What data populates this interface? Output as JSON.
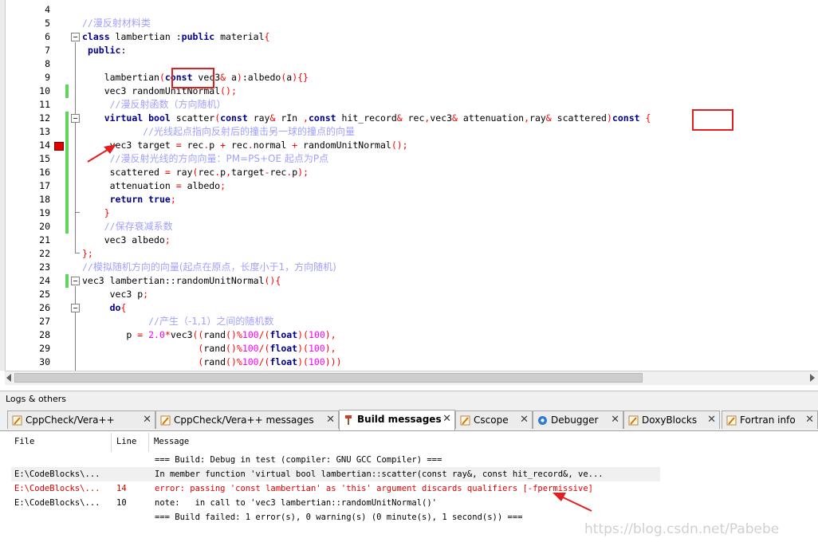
{
  "editor": {
    "lines": [
      {
        "num": "4",
        "tokens": []
      },
      {
        "num": "5",
        "tokens": [
          [
            "c",
            "//漫反射材料类"
          ]
        ]
      },
      {
        "num": "6",
        "tokens": [
          [
            "k",
            "class"
          ],
          [
            "",
            " lambertian :"
          ],
          [
            "k",
            "public"
          ],
          [
            "",
            " material"
          ],
          [
            "s",
            "{"
          ]
        ]
      },
      {
        "num": "7",
        "tokens": [
          [
            "",
            " "
          ],
          [
            "k",
            "public"
          ],
          [
            "",
            ":"
          ]
        ]
      },
      {
        "num": "8",
        "tokens": []
      },
      {
        "num": "9",
        "tokens": [
          [
            "",
            "    lambertian"
          ],
          [
            "s",
            "("
          ],
          [
            "k",
            "const"
          ],
          [
            "",
            " vec3"
          ],
          [
            "s",
            "&"
          ],
          [
            "",
            " a"
          ],
          [
            "s",
            ")"
          ],
          [
            "",
            ":albedo"
          ],
          [
            "s",
            "("
          ],
          [
            "",
            "a"
          ],
          [
            "s",
            "){}"
          ]
        ]
      },
      {
        "num": "10",
        "tokens": [
          [
            "",
            "    vec3 randomUnitNormal"
          ],
          [
            "s",
            "();"
          ]
        ]
      },
      {
        "num": "11",
        "tokens": [
          [
            "",
            "     "
          ],
          [
            "c",
            "//漫反射函数（方向随机）"
          ]
        ]
      },
      {
        "num": "12",
        "tokens": [
          [
            "",
            "    "
          ],
          [
            "k",
            "virtual"
          ],
          [
            "",
            " "
          ],
          [
            "k",
            "bool"
          ],
          [
            "",
            " scatter"
          ],
          [
            "s",
            "("
          ],
          [
            "k",
            "const"
          ],
          [
            "",
            " ray"
          ],
          [
            "s",
            "&"
          ],
          [
            "",
            " rIn "
          ],
          [
            "s",
            ","
          ],
          [
            "k",
            "const"
          ],
          [
            "",
            " hit_record"
          ],
          [
            "s",
            "&"
          ],
          [
            "",
            " rec"
          ],
          [
            "s",
            ","
          ],
          [
            "",
            "vec3"
          ],
          [
            "s",
            "&"
          ],
          [
            "",
            " attenuation"
          ],
          [
            "s",
            ","
          ],
          [
            "",
            "ray"
          ],
          [
            "s",
            "&"
          ],
          [
            "",
            " scattered"
          ],
          [
            "s",
            ")"
          ],
          [
            "k",
            "const"
          ],
          [
            "",
            " "
          ],
          [
            "s",
            "{"
          ]
        ]
      },
      {
        "num": "13",
        "tokens": [
          [
            "",
            "           "
          ],
          [
            "c",
            "//光线起点指向反射后的撞击另一球的撞点的向量"
          ]
        ]
      },
      {
        "num": "14",
        "tokens": [
          [
            "",
            "     vec3 target "
          ],
          [
            "s",
            "="
          ],
          [
            "",
            " rec"
          ],
          [
            "s",
            "."
          ],
          [
            "",
            "p "
          ],
          [
            "s",
            "+"
          ],
          [
            "",
            " rec"
          ],
          [
            "s",
            "."
          ],
          [
            "",
            "normal "
          ],
          [
            "s",
            "+"
          ],
          [
            "",
            " randomUnitNormal"
          ],
          [
            "s",
            "();"
          ]
        ]
      },
      {
        "num": "15",
        "tokens": [
          [
            "",
            "     "
          ],
          [
            "c",
            "//漫反射光线的方向向量：PM=PS+OE 起点为P点"
          ]
        ]
      },
      {
        "num": "16",
        "tokens": [
          [
            "",
            "     scattered "
          ],
          [
            "s",
            "="
          ],
          [
            "",
            " ray"
          ],
          [
            "s",
            "("
          ],
          [
            "",
            "rec"
          ],
          [
            "s",
            "."
          ],
          [
            "",
            "p"
          ],
          [
            "s",
            ","
          ],
          [
            "",
            "target"
          ],
          [
            "s",
            "-"
          ],
          [
            "",
            "rec"
          ],
          [
            "s",
            "."
          ],
          [
            "",
            "p"
          ],
          [
            "s",
            ");"
          ]
        ]
      },
      {
        "num": "17",
        "tokens": [
          [
            "",
            "     attenuation "
          ],
          [
            "s",
            "="
          ],
          [
            "",
            " albedo"
          ],
          [
            "s",
            ";"
          ]
        ]
      },
      {
        "num": "18",
        "tokens": [
          [
            "",
            "     "
          ],
          [
            "k",
            "return"
          ],
          [
            "",
            " "
          ],
          [
            "k",
            "true"
          ],
          [
            "s",
            ";"
          ]
        ]
      },
      {
        "num": "19",
        "tokens": [
          [
            "",
            "    "
          ],
          [
            "s",
            "}"
          ]
        ]
      },
      {
        "num": "20",
        "tokens": [
          [
            "",
            "    "
          ],
          [
            "c",
            "//保存衰减系数"
          ]
        ]
      },
      {
        "num": "21",
        "tokens": [
          [
            "",
            "    vec3 albedo"
          ],
          [
            "s",
            ";"
          ]
        ]
      },
      {
        "num": "22",
        "tokens": [
          [
            "s",
            "};"
          ]
        ]
      },
      {
        "num": "23",
        "tokens": [
          [
            "c",
            "//模拟随机方向的向量(起点在原点，长度小于1，方向随机)"
          ]
        ]
      },
      {
        "num": "24",
        "tokens": [
          [
            "",
            "vec3 lambertian::randomUnitNormal"
          ],
          [
            "s",
            "(){"
          ]
        ]
      },
      {
        "num": "25",
        "tokens": [
          [
            "",
            "     vec3 p"
          ],
          [
            "s",
            ";"
          ]
        ]
      },
      {
        "num": "26",
        "tokens": [
          [
            "",
            "     "
          ],
          [
            "k",
            "do"
          ],
          [
            "s",
            "{"
          ]
        ]
      },
      {
        "num": "27",
        "tokens": [
          [
            "",
            "            "
          ],
          [
            "c",
            "//产生（-1,1）之间的随机数"
          ]
        ]
      },
      {
        "num": "28",
        "tokens": [
          [
            "",
            "        p "
          ],
          [
            "s",
            "="
          ],
          [
            "",
            " "
          ],
          [
            "n",
            "2.0"
          ],
          [
            "s",
            "*"
          ],
          [
            "",
            "vec3"
          ],
          [
            "s",
            "(("
          ],
          [
            "",
            "rand"
          ],
          [
            "s",
            "()%"
          ],
          [
            "n",
            "100"
          ],
          [
            "s",
            "/("
          ],
          [
            "k",
            "float"
          ],
          [
            "s",
            ")("
          ],
          [
            "n",
            "100"
          ],
          [
            "s",
            "),"
          ]
        ]
      },
      {
        "num": "29",
        "tokens": [
          [
            "",
            "                     "
          ],
          [
            "s",
            "("
          ],
          [
            "",
            "rand"
          ],
          [
            "s",
            "()%"
          ],
          [
            "n",
            "100"
          ],
          [
            "s",
            "/("
          ],
          [
            "k",
            "float"
          ],
          [
            "s",
            ")("
          ],
          [
            "n",
            "100"
          ],
          [
            "s",
            "),"
          ]
        ]
      },
      {
        "num": "30",
        "tokens": [
          [
            "",
            "                     "
          ],
          [
            "s",
            "("
          ],
          [
            "",
            "rand"
          ],
          [
            "s",
            "()%"
          ],
          [
            "n",
            "100"
          ],
          [
            "s",
            "/("
          ],
          [
            "k",
            "float"
          ],
          [
            "s",
            ")("
          ],
          [
            "n",
            "100"
          ],
          [
            "s",
            ")))"
          ]
        ]
      }
    ]
  },
  "logs": {
    "title": "Logs & others",
    "tabs": [
      {
        "label": "CppCheck/Vera++",
        "icon": "pencil-icon",
        "active": false
      },
      {
        "label": "CppCheck/Vera++ messages",
        "icon": "pencil-icon",
        "active": false
      },
      {
        "label": "Build messages",
        "icon": "hammer-icon",
        "active": true
      },
      {
        "label": "Cscope",
        "icon": "pencil-icon",
        "active": false
      },
      {
        "label": "Debugger",
        "icon": "gear-icon",
        "active": false
      },
      {
        "label": "DoxyBlocks",
        "icon": "pencil-icon",
        "active": false
      },
      {
        "label": "Fortran info",
        "icon": "pencil-icon",
        "active": false
      }
    ],
    "close_glyph": "✕",
    "columns": {
      "file": "File",
      "line": "Line",
      "message": "Message"
    },
    "rows": [
      {
        "file": "",
        "line": "",
        "message": "=== Build: Debug in test (compiler: GNU GCC Compiler) ===",
        "type": "normal"
      },
      {
        "file": "E:\\CodeBlocks\\...",
        "line": "",
        "message": "In member function 'virtual bool lambertian::scatter(const ray&, const hit_record&, ve...",
        "type": "normal"
      },
      {
        "file": "E:\\CodeBlocks\\...",
        "line": "14",
        "message": "error: passing 'const lambertian' as 'this' argument discards qualifiers [-fpermissive]",
        "type": "error"
      },
      {
        "file": "E:\\CodeBlocks\\...",
        "line": "10",
        "message": "note:   in call to 'vec3 lambertian::randomUnitNormal()'",
        "type": "normal"
      },
      {
        "file": "",
        "line": "",
        "message": "=== Build failed: 1 error(s), 0 warning(s) (0 minute(s), 1 second(s)) ===",
        "type": "normal"
      }
    ]
  },
  "watermark": "https://blog.csdn.net/Pabebe",
  "colors": {
    "keyword": "#00008b",
    "operator": "#ff0000",
    "number": "#ff00ff",
    "comment": "#a0a0ff",
    "error": "#e00000",
    "change_bar": "#5fd45f",
    "annotation": "#e02020"
  }
}
